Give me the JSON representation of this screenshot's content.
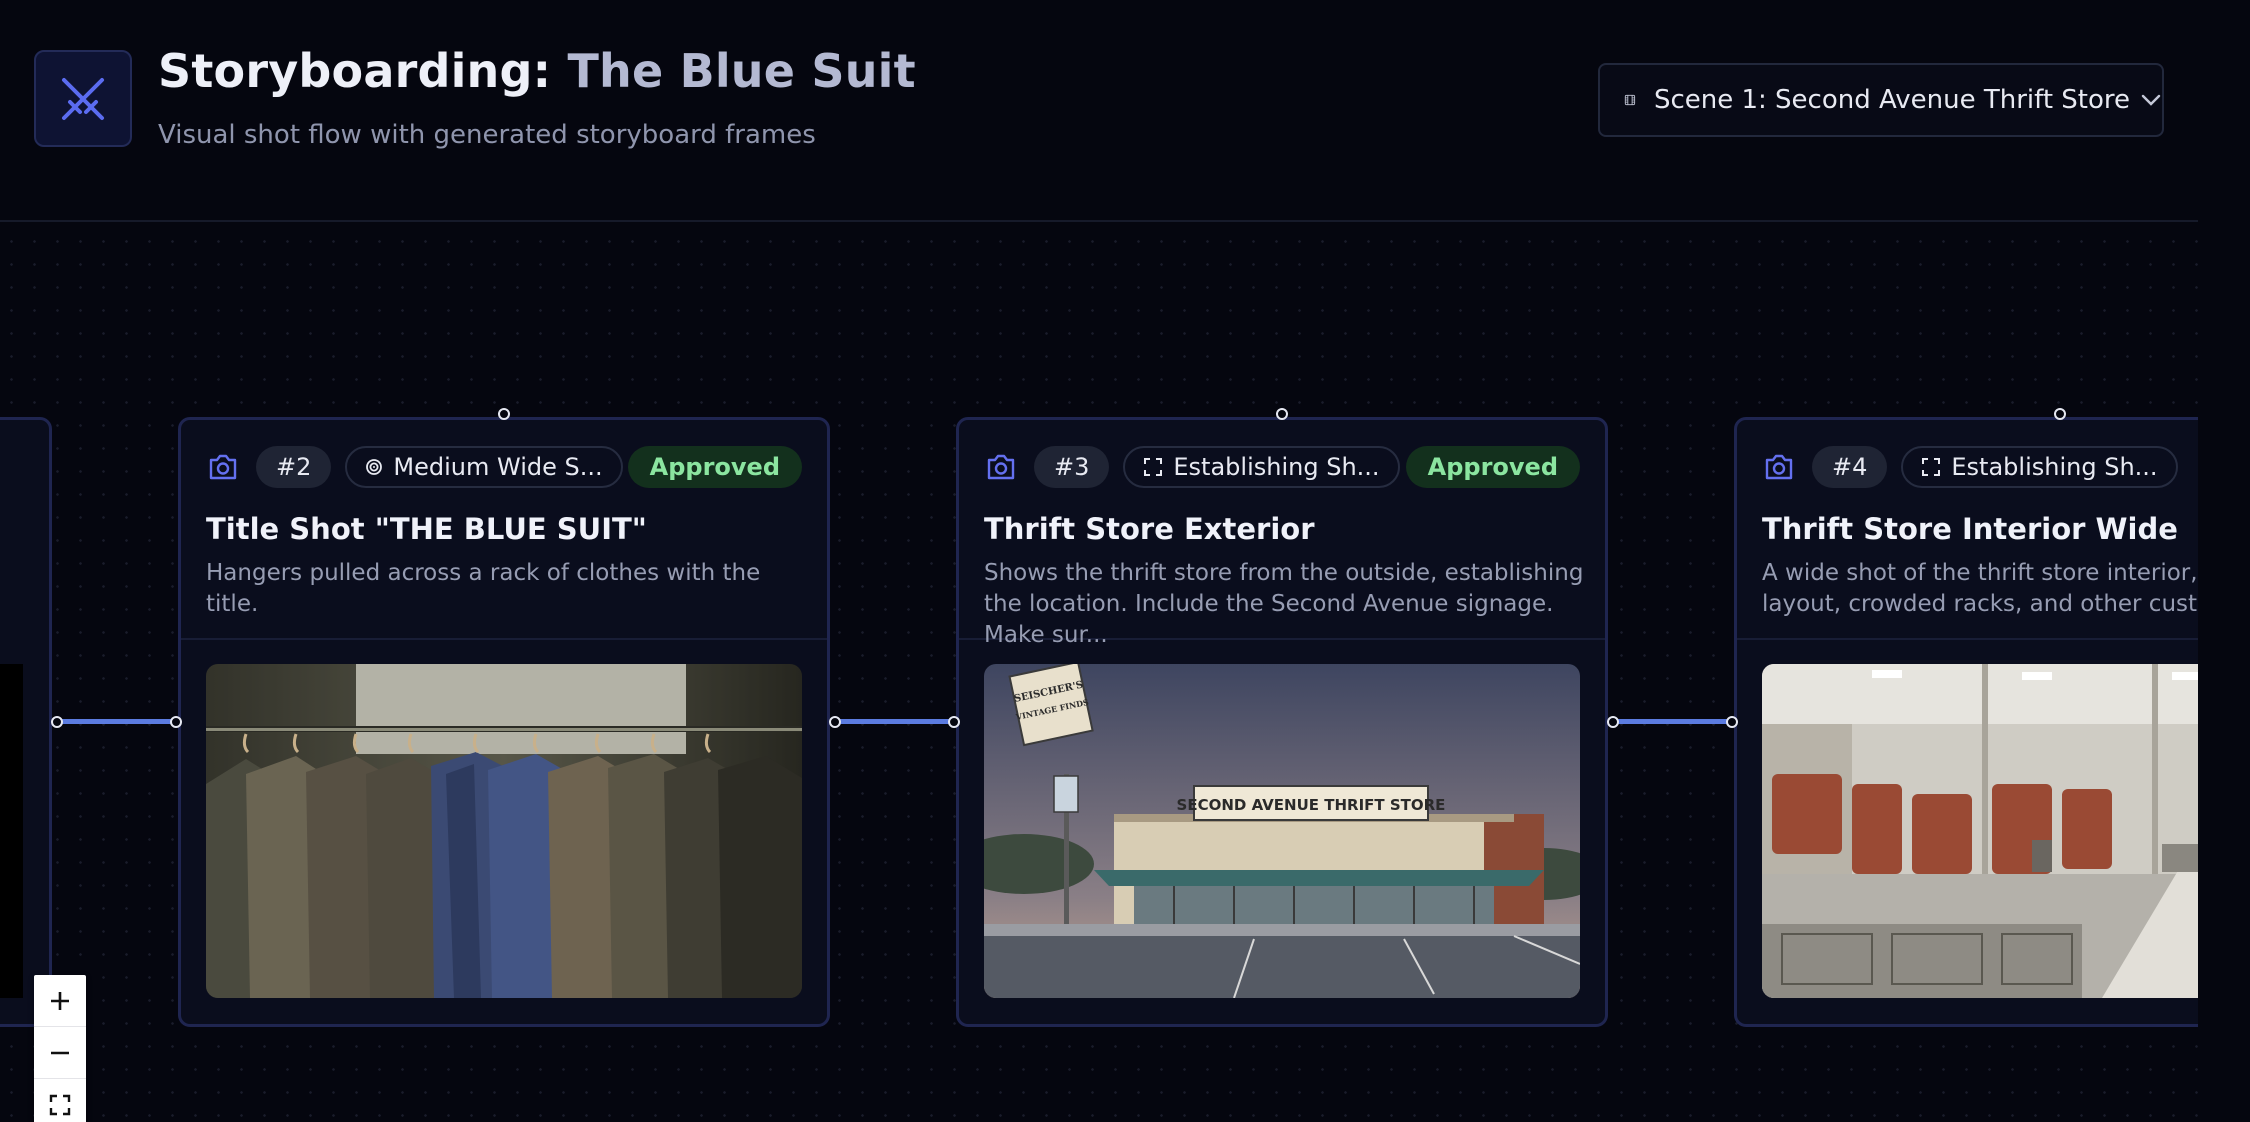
{
  "header": {
    "title_prefix": "Storyboarding:",
    "title_name": "The Blue Suit",
    "subtitle": "Visual shot flow with generated storyboard frames"
  },
  "scene_select": {
    "value": "Scene 1: Second Avenue Thrift Store"
  },
  "cards": [
    {
      "number": "#2",
      "shot_type": "Medium Wide S...",
      "shot_icon": "target-icon",
      "status": "Approved",
      "title": "Title Shot \"THE BLUE SUIT\"",
      "description": "Hangers pulled across a rack of clothes with the title.",
      "frame": "blue suit on clothing rack"
    },
    {
      "number": "#3",
      "shot_type": "Establishing Sh...",
      "shot_icon": "expand-icon",
      "status": "Approved",
      "title": "Thrift Store Exterior",
      "description": "Shows the thrift store from the outside, establishing the location. Include the Second Avenue signage. Make sur...",
      "frame": "thrift store storefront",
      "frame_text": {
        "main_sign": "SECOND AVENUE THRIFT STORE",
        "pole_sign_1": "SEISCHER'S",
        "pole_sign_2": "VINTAGE FINDS"
      }
    },
    {
      "number": "#4",
      "shot_type": "Establishing Sh...",
      "shot_icon": "expand-icon",
      "status": "",
      "title": "Thrift Store Interior Wide",
      "description": "A wide shot of the thrift store interior, showing the layout, crowded racks, and other customers.",
      "frame": "thrift store interior"
    }
  ],
  "colors": {
    "edge": "#5b7be0",
    "accent": "#5b6cf0",
    "approved_bg": "#13301d",
    "approved_text": "#8be5a0"
  }
}
